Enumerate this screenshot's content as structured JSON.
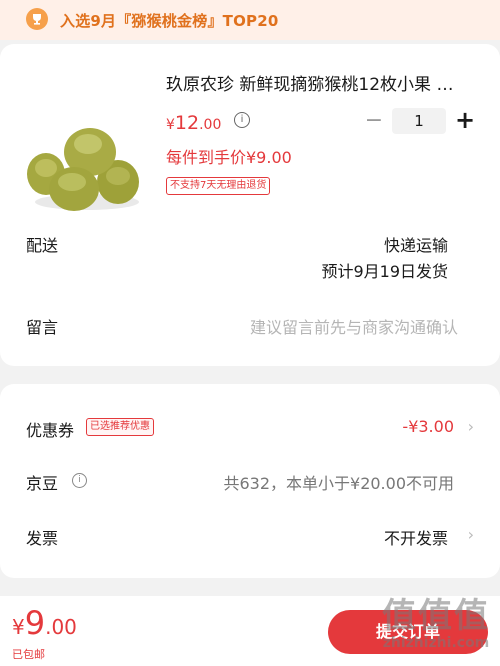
{
  "banner": {
    "text": "入选9月『猕猴桃金榜』TOP20",
    "accent": "#e0711d",
    "icon": "trophy-icon"
  },
  "product": {
    "title": "玖原农珍 新鲜现摘猕猴桃12枚小果 …",
    "price_symbol": "¥",
    "price_int": "12",
    "price_dec": ".00",
    "quantity": "1",
    "minus": "−",
    "plus": "+",
    "final_price": "每件到手价¥9.00",
    "return_tag": "不支持7天无理由退货"
  },
  "delivery": {
    "label": "配送",
    "method": "快递运输",
    "eta": "预计9月19日发货"
  },
  "message": {
    "label": "留言",
    "placeholder": "建议留言前先与商家沟通确认"
  },
  "coupon": {
    "label": "优惠券",
    "badge": "已选推荐优惠",
    "value": "-¥3.00"
  },
  "jingdou": {
    "label": "京豆",
    "value": "共632，本单小于¥20.00不可用"
  },
  "invoice": {
    "label": "发票",
    "value": "不开发票"
  },
  "footer": {
    "total_symbol": "¥",
    "total_int": "9",
    "total_dec": ".00",
    "shipping": "已包邮",
    "submit": "提交订单"
  },
  "watermark": {
    "logo": "值值值",
    "url": "zhizhizhi.com"
  },
  "colors": {
    "red": "#e4393c",
    "orange": "#e0711d"
  }
}
